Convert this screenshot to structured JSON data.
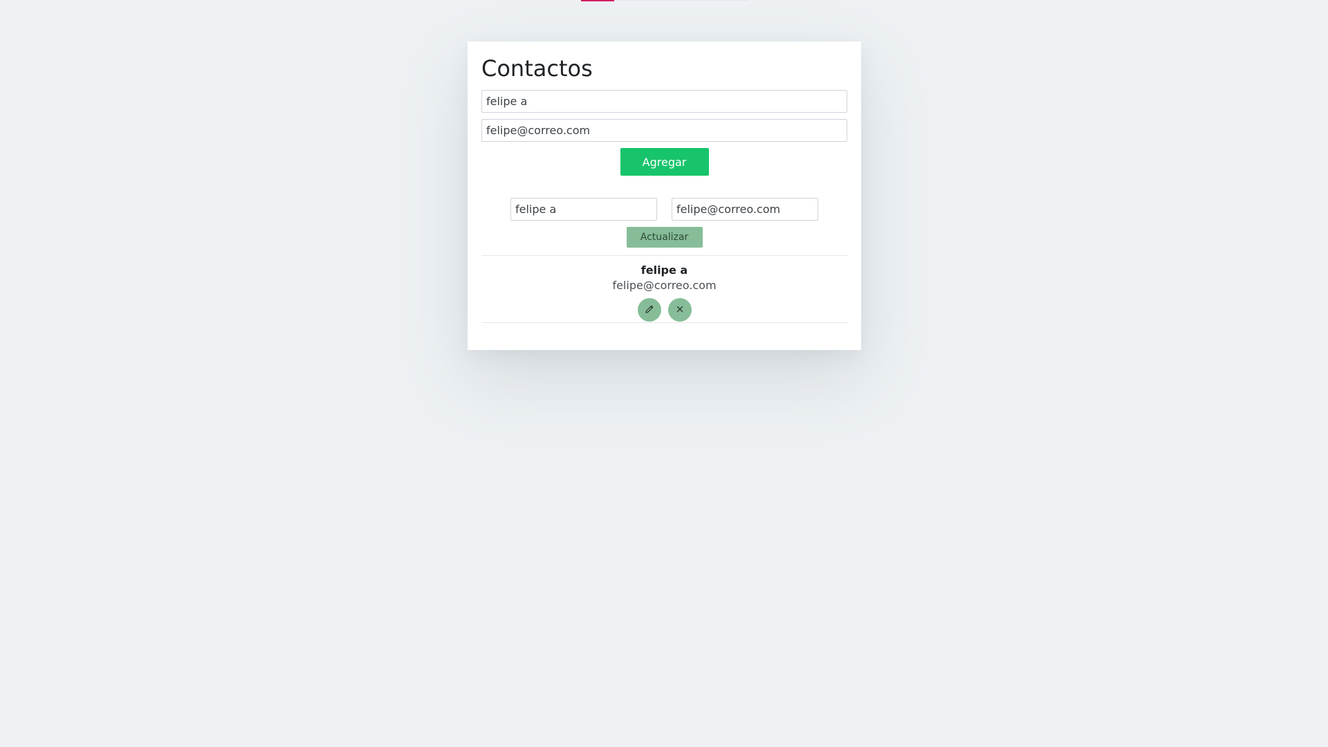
{
  "progress": {
    "fraction": 0.2,
    "accent_color": "#d21f5f"
  },
  "page": {
    "title": "Contactos"
  },
  "form": {
    "name_value": "felipe a",
    "email_value": "felipe@correo.com",
    "add_label": "Agregar",
    "add_color": "#17c46b"
  },
  "edit": {
    "name_value": "felipe a",
    "email_value": "felipe@correo.com",
    "update_label": "Actualizar",
    "update_color": "#86bd98"
  },
  "contacts": [
    {
      "name": "felipe a",
      "email": "felipe@correo.com",
      "edit_icon": "pencil-icon",
      "delete_icon": "close-icon"
    }
  ]
}
